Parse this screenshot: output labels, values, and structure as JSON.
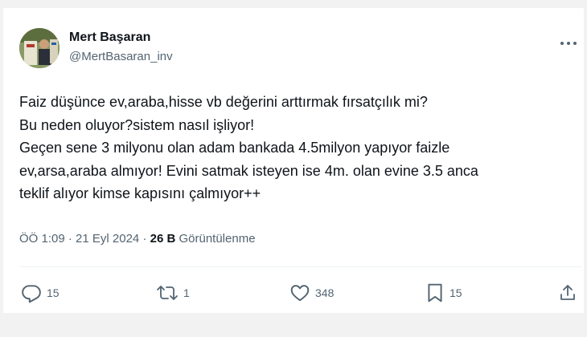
{
  "author": {
    "name": "Mert Başaran",
    "handle": "@MertBasaran_inv",
    "avatar_icon": "profile-photo"
  },
  "tweet": {
    "lines": [
      "Faiz düşünce ev,araba,hisse vb değerini arttırmak fırsatçılık mi?",
      "Bu neden oluyor?sistem nasıl işliyor!",
      "Geçen sene 3 milyonu olan adam bankada 4.5milyon yapıyor faizle",
      "ev,arsa,araba almıyor! Evini satmak isteyen ise 4m. olan evine 3.5 anca",
      "teklif alıyor kimse kapısını çalmıyor++"
    ]
  },
  "meta": {
    "time": "ÖÖ 1:09",
    "separator1": "·",
    "date": "21 Eyl 2024",
    "separator2": "·",
    "views_count": "26 B",
    "views_label": "Görüntülenme"
  },
  "actions": {
    "reply": {
      "icon": "reply-icon",
      "count": "15"
    },
    "repost": {
      "icon": "repost-icon",
      "count": "1"
    },
    "like": {
      "icon": "heart-icon",
      "count": "348"
    },
    "bookmark": {
      "icon": "bookmark-icon",
      "count": "15"
    },
    "share": {
      "icon": "share-icon"
    }
  },
  "colors": {
    "text_primary": "#0f1419",
    "text_secondary": "#536471",
    "divider": "#eff3f4",
    "background": "#ffffff"
  }
}
